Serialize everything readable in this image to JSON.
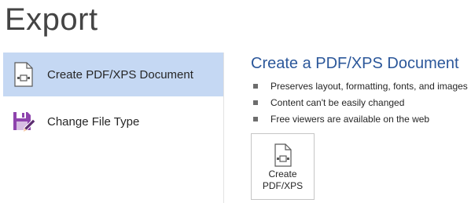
{
  "page": {
    "title": "Export"
  },
  "nav": {
    "items": [
      {
        "label": "Create PDF/XPS Document",
        "icon": "pdf-document-icon",
        "selected": true
      },
      {
        "label": "Change File Type",
        "icon": "save-as-icon",
        "selected": false
      }
    ]
  },
  "detail": {
    "title": "Create a PDF/XPS Document",
    "bullets": [
      "Preserves layout, formatting, fonts, and images",
      "Content can't be easily changed",
      "Free viewers are available on the web"
    ],
    "button": {
      "line1": "Create",
      "line2": "PDF/XPS",
      "icon": "pdf-document-icon"
    }
  },
  "colors": {
    "accent": "#2b579a",
    "selected_bg": "#c5d8f3",
    "save_icon": "#7d3c98"
  }
}
